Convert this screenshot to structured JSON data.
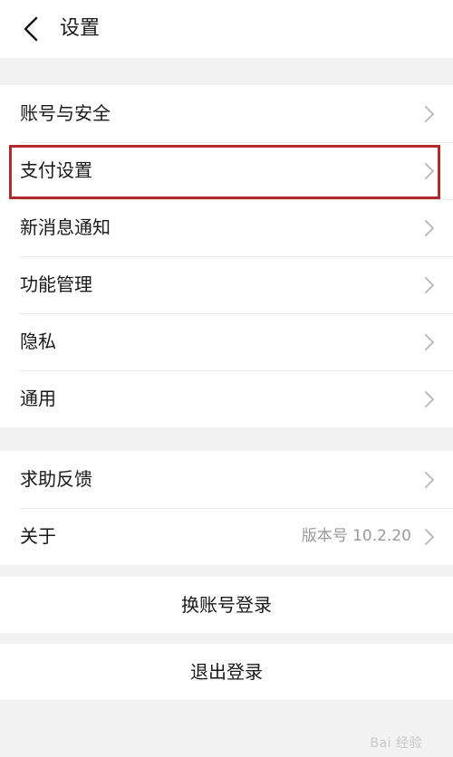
{
  "header": {
    "title": "设置",
    "back_icon": "chevron-left-icon"
  },
  "group1": {
    "items": [
      {
        "label": "账号与安全",
        "icon": "chevron-right-icon"
      },
      {
        "label": "支付设置",
        "icon": "chevron-right-icon",
        "highlighted": true
      },
      {
        "label": "新消息通知",
        "icon": "chevron-right-icon"
      },
      {
        "label": "功能管理",
        "icon": "chevron-right-icon"
      },
      {
        "label": "隐私",
        "icon": "chevron-right-icon"
      },
      {
        "label": "通用",
        "icon": "chevron-right-icon"
      }
    ]
  },
  "group2": {
    "items": [
      {
        "label": "求助反馈",
        "icon": "chevron-right-icon"
      },
      {
        "label": "关于",
        "value": "版本号 10.2.20",
        "icon": "chevron-right-icon"
      }
    ]
  },
  "actions": {
    "switch_account": "换账号登录",
    "logout": "退出登录"
  },
  "watermark": "Bai 经验",
  "colors": {
    "background": "#f2f2f2",
    "surface": "#ffffff",
    "highlight_border": "#b22a2a",
    "secondary_text": "#9a9a9a"
  }
}
